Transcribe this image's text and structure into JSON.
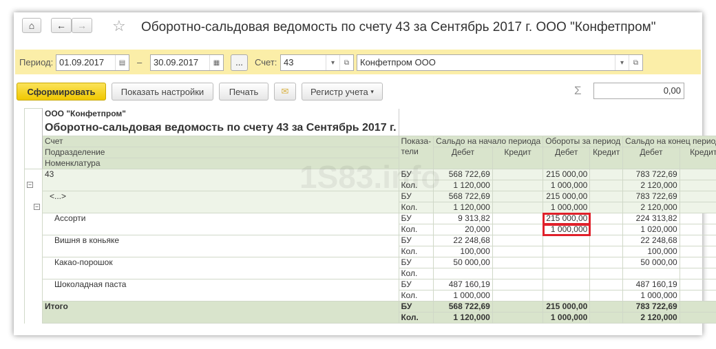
{
  "header": {
    "title": "Оборотно-сальдовая ведомость по счету 43 за Сентябрь 2017 г. ООО \"Конфетпром\""
  },
  "filter": {
    "period_label": "Период:",
    "date_from": "01.09.2017",
    "dash": "–",
    "date_to": "30.09.2017",
    "more": "...",
    "account_label": "Счет:",
    "account": "43",
    "org": "Конфетпром ООО"
  },
  "toolbar": {
    "generate": "Сформировать",
    "settings": "Показать настройки",
    "print": "Печать",
    "register": "Регистр учета",
    "sum_symbol": "Σ",
    "sum_value": "0,00"
  },
  "report": {
    "org": "ООО \"Конфетпром\"",
    "title": "Оборотно-сальдовая ведомость по счету 43 за Сентябрь 2017 г.",
    "h_account": "Счет",
    "h_division": "Подразделение",
    "h_item": "Номенклатура",
    "h_ind1": "Показа-",
    "h_ind2": "тели",
    "h_open": "Сальдо на начало периода",
    "h_turn": "Обороты за период",
    "h_close": "Сальдо на конец периода",
    "debit": "Дебет",
    "credit": "Кредит",
    "watermark": "1S83.info",
    "rows": [
      {
        "name": "43",
        "cls": "g",
        "lines": [
          [
            "БУ",
            "568 722,69",
            "",
            "215 000,00",
            "",
            "783 722,69",
            ""
          ],
          [
            "Кол.",
            "1 120,000",
            "",
            "1 000,000",
            "",
            "2 120,000",
            ""
          ]
        ]
      },
      {
        "name": "<...>",
        "cls": "g",
        "indent": 1,
        "lines": [
          [
            "БУ",
            "568 722,69",
            "",
            "215 000,00",
            "",
            "783 722,69",
            ""
          ],
          [
            "Кол.",
            "1 120,000",
            "",
            "1 000,000",
            "",
            "2 120,000",
            ""
          ]
        ]
      },
      {
        "name": "Ассорти",
        "indent": 2,
        "hl": true,
        "lines": [
          [
            "БУ",
            "9 313,82",
            "",
            "215 000,00",
            "",
            "224 313,82",
            ""
          ],
          [
            "Кол.",
            "20,000",
            "",
            "1 000,000",
            "",
            "1 020,000",
            ""
          ]
        ]
      },
      {
        "name": "Вишня в коньяке",
        "indent": 2,
        "lines": [
          [
            "БУ",
            "22 248,68",
            "",
            "",
            "",
            "22 248,68",
            ""
          ],
          [
            "Кол.",
            "100,000",
            "",
            "",
            "",
            "100,000",
            ""
          ]
        ]
      },
      {
        "name": "Какао-порошок",
        "indent": 2,
        "lines": [
          [
            "БУ",
            "50 000,00",
            "",
            "",
            "",
            "50 000,00",
            ""
          ],
          [
            "Кол.",
            "",
            "",
            "",
            "",
            "",
            ""
          ]
        ]
      },
      {
        "name": "Шоколадная паста",
        "indent": 2,
        "lines": [
          [
            "БУ",
            "487 160,19",
            "",
            "",
            "",
            "487 160,19",
            ""
          ],
          [
            "Кол.",
            "1 000,000",
            "",
            "",
            "",
            "1 000,000",
            ""
          ]
        ]
      },
      {
        "name": "Итого",
        "cls": "tot",
        "lines": [
          [
            "БУ",
            "568 722,69",
            "",
            "215 000,00",
            "",
            "783 722,69",
            ""
          ],
          [
            "Кол.",
            "1 120,000",
            "",
            "1 000,000",
            "",
            "2 120,000",
            ""
          ]
        ]
      }
    ]
  }
}
